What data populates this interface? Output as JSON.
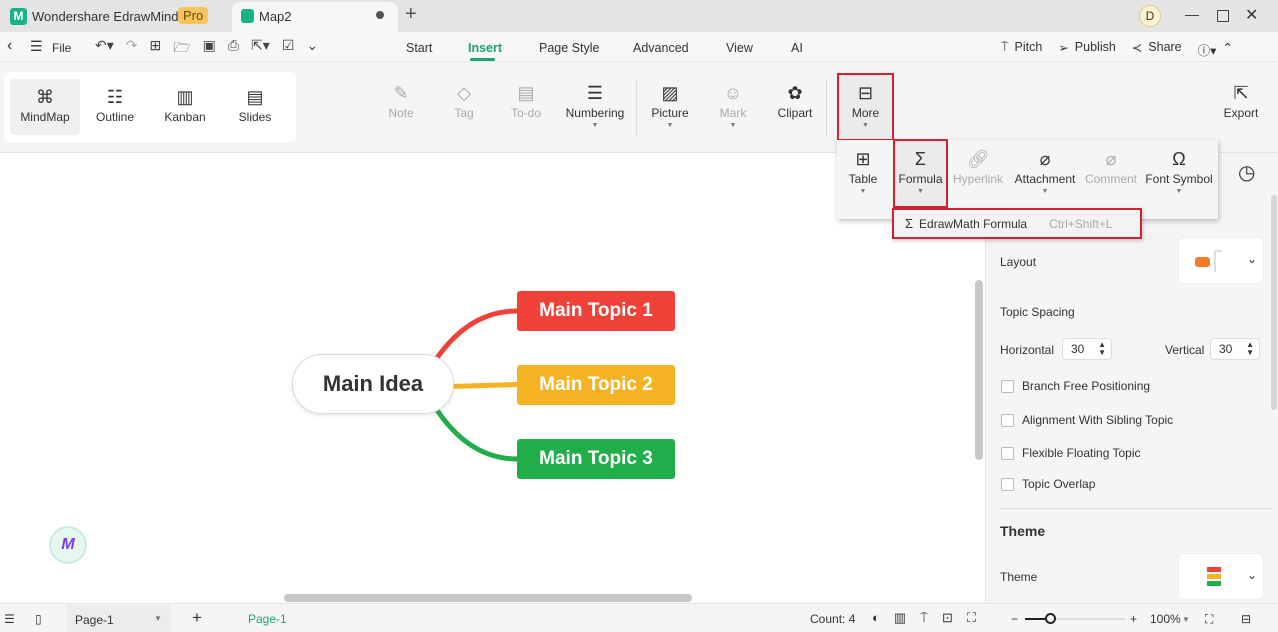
{
  "app": {
    "name": "Wondershare EdrawMind",
    "badge": "Pro",
    "doc_tab": "Map2",
    "avatar": "D"
  },
  "menu": {
    "file": "File",
    "tabs": [
      "Start",
      "Insert",
      "Page Style",
      "Advanced",
      "View",
      "AI"
    ],
    "active_tab": "Insert",
    "right": [
      "Pitch",
      "Publish",
      "Share"
    ]
  },
  "views": [
    "MindMap",
    "Outline",
    "Kanban",
    "Slides"
  ],
  "ribbon": {
    "note": "Note",
    "tag": "Tag",
    "todo": "To-do",
    "numbering": "Numbering",
    "picture": "Picture",
    "mark": "Mark",
    "clipart": "Clipart",
    "more": "More",
    "export": "Export"
  },
  "more_menu": {
    "table": "Table",
    "formula": "Formula",
    "hyperlink": "Hyperlink",
    "attachment": "Attachment",
    "comment": "Comment",
    "font_symbol": "Font Symbol"
  },
  "formula_menu": {
    "item": "EdrawMath Formula",
    "shortcut": "Ctrl+Shift+L"
  },
  "mindmap": {
    "central": "Main Idea",
    "topics": [
      {
        "label": "Main Topic 1",
        "color": "#f04138"
      },
      {
        "label": "Main Topic 2",
        "color": "#f5b324"
      },
      {
        "label": "Main Topic 3",
        "color": "#22ad4b"
      }
    ]
  },
  "panel": {
    "layout": "Layout",
    "topic_spacing": "Topic Spacing",
    "horizontal": "Horizontal",
    "horizontal_value": "30",
    "vertical": "Vertical",
    "vertical_value": "30",
    "checks": [
      "Branch Free Positioning",
      "Alignment With Sibling Topic",
      "Flexible Floating Topic",
      "Topic Overlap"
    ],
    "theme_heading": "Theme",
    "theme": "Theme"
  },
  "status": {
    "page_select": "Page-1",
    "page_tab": "Page-1",
    "count": "Count: 4",
    "zoom": "100%",
    "zoom_fraction": 0.25
  },
  "colors": {
    "accent": "#1aa37a",
    "highlight": "#d0232f"
  }
}
